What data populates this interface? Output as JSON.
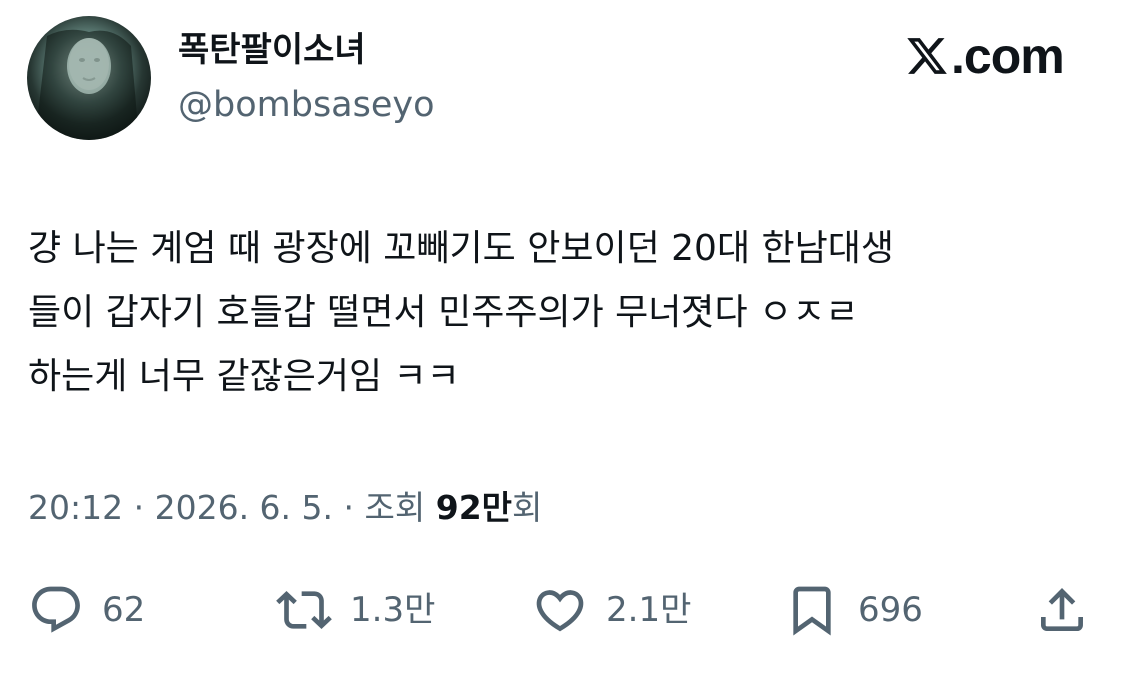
{
  "author": {
    "display_name": "폭탄팔이소녀",
    "handle": "@bombsaseyo"
  },
  "brand": {
    "text": ".com",
    "icon": "x-logo-icon"
  },
  "tweet": {
    "lines": [
      "걍 나는 계엄 때 광장에 꼬빼기도 안보이던 20대 한남대생",
      "들이 갑자기 호들갑 떨면서 민주주의가 무너졋다 ㅇㅈㄹ",
      "하는게 너무 같잖은거임 ㅋㅋ"
    ]
  },
  "meta": {
    "time": "20:12",
    "sep": " · ",
    "date": "2026. 6. 5.",
    "views_label": "조회 ",
    "views_count": "92만",
    "views_suffix": "회"
  },
  "actions": {
    "reply": {
      "icon": "reply-icon",
      "count": "62"
    },
    "retweet": {
      "icon": "retweet-icon",
      "count": "1.3만"
    },
    "like": {
      "icon": "heart-icon",
      "count": "2.1만"
    },
    "bookmark": {
      "icon": "bookmark-icon",
      "count": "696"
    },
    "share": {
      "icon": "share-icon"
    }
  },
  "colors": {
    "text_primary": "#0f1419",
    "text_secondary": "#536471",
    "background": "#ffffff"
  }
}
